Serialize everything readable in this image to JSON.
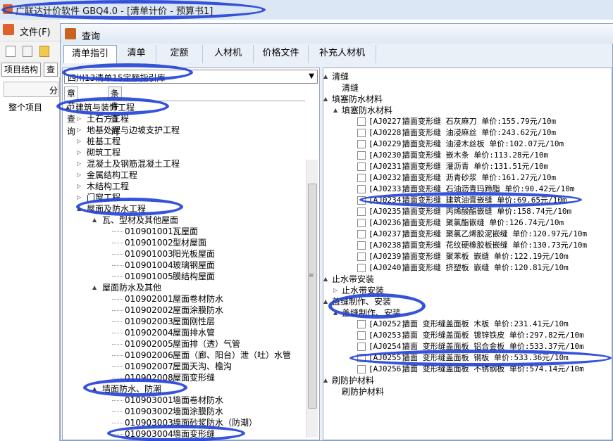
{
  "app": {
    "title": "广联达计价软件 GBQ4.0 - [清单计价 - 预算书1]",
    "menu_file": "文件(F)",
    "left_tabs": [
      "项目结构",
      "查"
    ],
    "left_header": "分",
    "whole_project": "整个项目"
  },
  "dialog": {
    "title": "查询",
    "tabs": [
      "清单指引",
      "清单",
      "定额",
      "人材机",
      "价格文件",
      "补充人材机"
    ],
    "active_tab": "清单指引",
    "library_select": "四川13清单15定额指引库",
    "subtabs": [
      "章节查询",
      "条件查询"
    ]
  },
  "left_tree": [
    {
      "label": "建筑与装饰工程",
      "level": 0,
      "expander": "▲"
    },
    {
      "label": "土石方工程",
      "level": 1,
      "expander": "▷"
    },
    {
      "label": "地基处理与边坡支护工程",
      "level": 1,
      "expander": "▷"
    },
    {
      "label": "桩基工程",
      "level": 1,
      "expander": "▷"
    },
    {
      "label": "砌筑工程",
      "level": 1,
      "expander": "▷"
    },
    {
      "label": "混凝土及钢筋混凝土工程",
      "level": 1,
      "expander": "▷"
    },
    {
      "label": "金属结构工程",
      "level": 1,
      "expander": "▷"
    },
    {
      "label": "木结构工程",
      "level": 1,
      "expander": "▷"
    },
    {
      "label": "门窗工程",
      "level": 1,
      "expander": "▷"
    },
    {
      "label": "屋面及防水工程",
      "level": 1,
      "expander": "▲"
    },
    {
      "label": "瓦、型材及其他屋面",
      "level": 2,
      "expander": "▲"
    },
    {
      "code": "010901001",
      "label": "瓦屋面",
      "level": 3
    },
    {
      "code": "010901002",
      "label": "型材屋面",
      "level": 3
    },
    {
      "code": "010901003",
      "label": "阳光板屋面",
      "level": 3
    },
    {
      "code": "010901004",
      "label": "玻璃钢屋面",
      "level": 3
    },
    {
      "code": "010901005",
      "label": "膜结构屋面",
      "level": 3
    },
    {
      "label": "屋面防水及其他",
      "level": 2,
      "expander": "▲"
    },
    {
      "code": "010902001",
      "label": "屋面卷材防水",
      "level": 3
    },
    {
      "code": "010902002",
      "label": "屋面涂膜防水",
      "level": 3
    },
    {
      "code": "010902003",
      "label": "屋面刚性层",
      "level": 3
    },
    {
      "code": "010902004",
      "label": "屋面排水管",
      "level": 3
    },
    {
      "code": "010902005",
      "label": "屋面排（透）气管",
      "level": 3
    },
    {
      "code": "010902006",
      "label": "屋面（廊、阳台）泄（吐）水管",
      "level": 3
    },
    {
      "code": "010902007",
      "label": "屋面天沟、檐沟",
      "level": 3
    },
    {
      "code": "010902008",
      "label": "屋面变形缝",
      "level": 3
    },
    {
      "label": "墙面防水、防潮",
      "level": 2,
      "expander": "▲"
    },
    {
      "code": "010903001",
      "label": "墙面卷材防水",
      "level": 3
    },
    {
      "code": "010903002",
      "label": "墙面涂膜防水",
      "level": 3
    },
    {
      "code": "010903003",
      "label": "墙面砂浆防水（防潮）",
      "level": 3
    },
    {
      "code": "010903004",
      "label": "墙面变形缝",
      "level": 3
    }
  ],
  "right_tree": [
    {
      "type": "node",
      "label": "清缝",
      "level": 0,
      "expander": "▲"
    },
    {
      "type": "node",
      "label": "清缝",
      "level": 1
    },
    {
      "type": "node",
      "label": "填塞防水材料",
      "level": 0,
      "expander": "▲"
    },
    {
      "type": "node",
      "label": "填塞防水材料",
      "level": 1,
      "expander": "▲"
    },
    {
      "type": "item",
      "code": "[AJ0227]",
      "text": "墙面变形缝 石灰麻刀 单价:155.79元/10m"
    },
    {
      "type": "item",
      "code": "[AJ0228]",
      "text": "墙面变形缝 油浸麻丝 单价:243.62元/10m"
    },
    {
      "type": "item",
      "code": "[AJ0229]",
      "text": "墙面变形缝 油浸木丝板 单价:102.07元/10m"
    },
    {
      "type": "item",
      "code": "[AJ0230]",
      "text": "墙面变形缝 嵌木条 单价:113.28元/10m"
    },
    {
      "type": "item",
      "code": "[AJ0231]",
      "text": "墙面变形缝 灌沥青 单价:131.51元/10m"
    },
    {
      "type": "item",
      "code": "[AJ0232]",
      "text": "墙面变形缝 沥青砂浆 单价:161.27元/10m"
    },
    {
      "type": "item",
      "code": "[AJ0233]",
      "text": "墙面变形缝 石油沥青玛蹄脂 单价:90.42元/10m"
    },
    {
      "type": "item",
      "code": "[AJ0234]",
      "text": "墙面变形缝 建筑油膏嵌缝 单价:69.65元/10m"
    },
    {
      "type": "item",
      "code": "[AJ0235]",
      "text": "墙面变形缝 丙烯酸酯嵌缝 单价:158.74元/10m"
    },
    {
      "type": "item",
      "code": "[AJ0236]",
      "text": "墙面变形缝 聚氯酯嵌缝 单价:126.74元/10m"
    },
    {
      "type": "item",
      "code": "[AJ0237]",
      "text": "墙面变形缝 聚氯乙烯胶泥嵌缝 单价:120.97元/10m"
    },
    {
      "type": "item",
      "code": "[AJ0238]",
      "text": "墙面变形缝 花纹硬橡胶板嵌缝 单价:130.73元/10m"
    },
    {
      "type": "item",
      "code": "[AJ0239]",
      "text": "墙面变形缝 聚苯板 嵌缝 单价:122.19元/10m"
    },
    {
      "type": "item",
      "code": "[AJ0240]",
      "text": "墙面变形缝 挤塑板 嵌缝 单价:120.81元/10m"
    },
    {
      "type": "node",
      "label": "止水带安装",
      "level": 0,
      "expander": "▲"
    },
    {
      "type": "node",
      "label": "止水带安装",
      "level": 1,
      "expander": "▷"
    },
    {
      "type": "node",
      "label": "盖缝制作、安装",
      "level": 0,
      "expander": "▲"
    },
    {
      "type": "node",
      "label": "盖缝制作、安装",
      "level": 1,
      "expander": "▲"
    },
    {
      "type": "item",
      "code": "[AJ0252]",
      "text": "墙面 变形缝盖面板 木板 单价:231.41元/10m"
    },
    {
      "type": "item",
      "code": "[AJ0253]",
      "text": "墙面 变形缝盖面板 镀锌铁皮 单价:297.82元/10m"
    },
    {
      "type": "item",
      "code": "[AJ0254]",
      "text": "墙面 变形缝盖面板 铝合金板 单价:533.37元/10m"
    },
    {
      "type": "item",
      "code": "[AJ0255]",
      "text": "墙面 变形缝盖面板 钢板 单价:533.36元/10m"
    },
    {
      "type": "item",
      "code": "[AJ0256]",
      "text": "墙面 变形缝盖面板 不锈钢板 单价:574.14元/10m"
    },
    {
      "type": "node",
      "label": "刷防护材料",
      "level": 0,
      "expander": "▲"
    },
    {
      "type": "node",
      "label": "刷防护材料",
      "level": 1
    }
  ]
}
